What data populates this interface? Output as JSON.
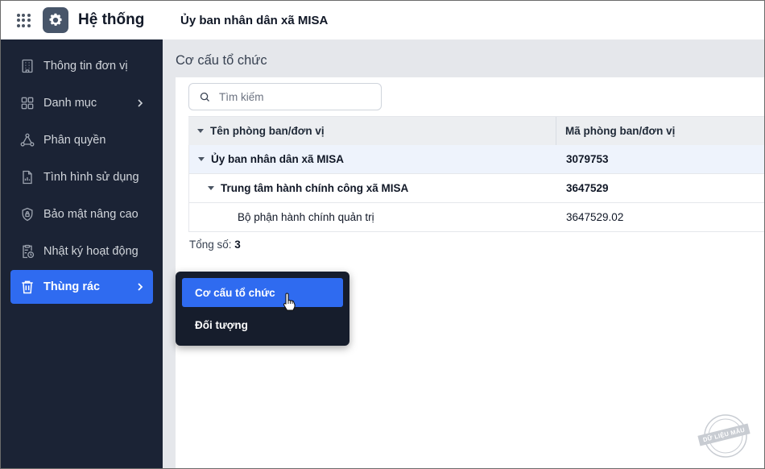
{
  "header": {
    "app_title": "Hệ thống",
    "org_name": "Ủy ban nhân dân xã MISA"
  },
  "sidebar": {
    "items": [
      {
        "label": "Thông tin đơn vị",
        "icon": "building-icon"
      },
      {
        "label": "Danh mục",
        "icon": "grid-icon",
        "has_submenu": true
      },
      {
        "label": "Phân quyền",
        "icon": "share-nodes-icon"
      },
      {
        "label": "Tình hình sử dụng",
        "icon": "chart-file-icon"
      },
      {
        "label": "Bảo mật nâng cao",
        "icon": "shield-lock-icon"
      },
      {
        "label": "Nhật ký hoạt động",
        "icon": "clipboard-clock-icon"
      },
      {
        "label": "Thùng rác",
        "icon": "trash-icon",
        "has_submenu": true,
        "active": true
      }
    ]
  },
  "main": {
    "title": "Cơ cấu tổ chức",
    "search": {
      "placeholder": "Tìm kiếm"
    },
    "table": {
      "columns": [
        "Tên phòng ban/đơn vị",
        "Mã phòng ban/đơn vị"
      ],
      "rows": [
        {
          "name": "Ủy ban nhân dân xã MISA",
          "code": "3079753",
          "level": 0,
          "expanded": true,
          "bold": true,
          "selected": true
        },
        {
          "name": "Trung tâm hành chính công xã MISA",
          "code": "3647529",
          "level": 1,
          "expanded": true,
          "bold": true
        },
        {
          "name": "Bộ phận hành chính quản trị",
          "code": "3647529.02",
          "level": 2
        }
      ]
    },
    "total_label": "Tổng số:",
    "total_value": "3"
  },
  "popup_menu": {
    "items": [
      {
        "label": "Cơ cấu tổ chức",
        "active": true
      },
      {
        "label": "Đối tượng"
      }
    ]
  },
  "watermark": {
    "text": "DỮ LIỆU MẪU"
  },
  "colors": {
    "sidebar_bg": "#1b2335",
    "accent": "#2f6bf0",
    "popup_bg": "#161d2c",
    "selected_row": "#eef3fc"
  }
}
